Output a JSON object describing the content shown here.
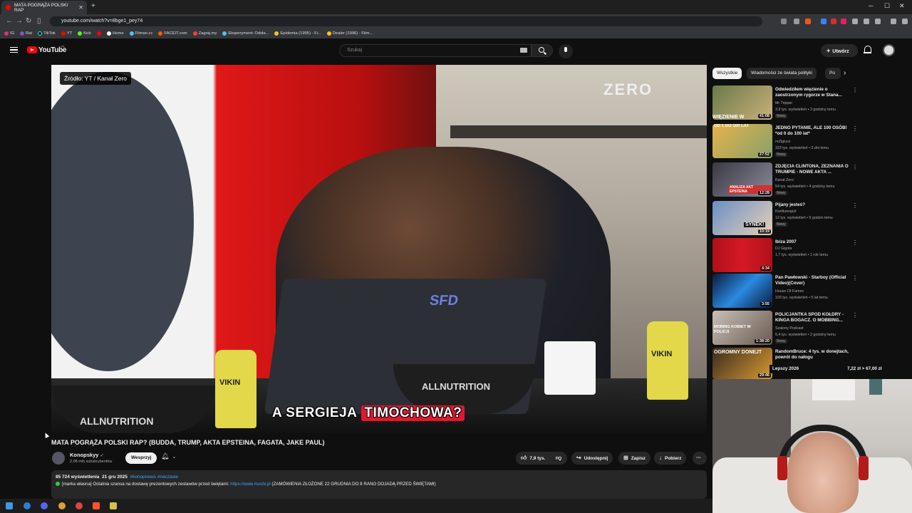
{
  "browser": {
    "tab_title": "MATA POGRĄŻA POLSKI RAP",
    "url": "youtube.com/watch?v=8bge1_pey74",
    "bookmarks": [
      "IG",
      "Rat",
      "TikTok",
      "YT",
      "Kick",
      "Home",
      "Filman.cc",
      "FACEIT.com",
      "Zagraj.my",
      "Eksperyment: Odsła...",
      "Epidemia (1995) - Fi...",
      "Dealer (1996) - Film..."
    ]
  },
  "header": {
    "logo_text": "YouTube",
    "country": "PL",
    "search_placeholder": "Szukaj",
    "create_label": "Utwórz"
  },
  "player": {
    "source_badge": "Źródło: YT / Kanał Zero",
    "watermark": "ZERO",
    "caption_a": "A SERGIEJA",
    "caption_b": "TIMOCHOWA?",
    "laptop_sticker": "SFD",
    "bowl_brand": "ALLNUTRITION",
    "bottle_label": "VIKIN"
  },
  "video": {
    "title": "MATA POGRĄŻA POLSKI RAP? (BUDDA, TRUMP, AKTA EPSTEINA, FAGATA, JAKE PAUL)",
    "channel": "Konopskyy",
    "subscribers": "2,08 mln subskrybentów",
    "support_label": "Wesprzyj",
    "likes": "7,9 tys.",
    "share_label": "Udostępnij",
    "save_label": "Zapisz",
    "download_label": "Pobierz",
    "views": "85 724 wyświetlenia",
    "date": "21 gru 2025",
    "tags": "#konopnews #naczasie",
    "desc_prefix": "[marka własna] Ostatnia szansa na dostawę prezentowych zestawów przed świętami:",
    "desc_link": "https://www.mushi.pl",
    "desc_suffix": "(ZAMÓWIENIA ZŁOŻONE 22 GRUDNIA DO 8 RANO DOJADĄ PRZED ŚWIĘTAMI)"
  },
  "sidebar": {
    "chips": [
      "Wszystkie",
      "Wiadomości ze świata polityki",
      "Po"
    ],
    "items": [
      {
        "title": "Odwiedziłem więzienie o zaostrzonym rygorze w Stana...",
        "channel": "Mr Tripper",
        "meta": "3,9 tys. wyświetleń • 3 godziny temu",
        "badge": "Nowy",
        "duration": "41:08",
        "thumb_text": "WIĘZIENIE W"
      },
      {
        "title": "JEDNO PYTANIE, ALE 100 OSÓB! *od 0 do 100 lat*",
        "channel": "reZigiusz",
        "meta": "323 tys. wyświetleń • 3 dni temu",
        "badge": "Nowy",
        "duration": "27:52",
        "thumb_text": "OD 1 DO 100 LAT"
      },
      {
        "title": "ZDJĘCIA CLINTONA, ZEZNANIA O TRUMPIE - NOWE AKTA ...",
        "channel": "Kanał Zero",
        "meta": "54 tys. wyświetleń • 4 godziny temu",
        "badge": "Nowy",
        "duration": "12:28",
        "thumb_text": "ANALIZA AKT EPSTEINA"
      },
      {
        "title": "Pijany jesteś?",
        "channel": "Konfiurespol",
        "meta": "12 tys. wyświetleń • 6 godzin temu",
        "badge": "Nowy",
        "duration": "10:19",
        "thumb_text": "SYNEK!"
      },
      {
        "title": "Ibiza 2007",
        "channel": "DJ Gigola",
        "meta": "1,7 tys. wyświetleń • 1 rok temu",
        "badge": "",
        "duration": "4:34",
        "thumb_text": ""
      },
      {
        "title": "Pan Pawłowski - Starboy (Official Video)(Cover)",
        "channel": "House Of Fames",
        "meta": "103 tys. wyświetleń • 5 lat temu",
        "badge": "",
        "duration": "3:55",
        "thumb_text": ""
      },
      {
        "title": "POLICJANTKA SPOD KOŁDRY - KINGA BOGACZ. O MOBBING...",
        "channel": "Szalony Podcast",
        "meta": "5,4 tys. wyświetleń • 2 godziny temu",
        "badge": "Nowy",
        "duration": "1:38:20",
        "thumb_text": "MOBING KOBIET W POLICJI"
      },
      {
        "title": "RandomBruce: 4 tys. w donejtach, powrót do nałogu",
        "channel": "",
        "meta": "",
        "badge": "",
        "duration": "29:46",
        "thumb_text": "OGROMNY DONEJT"
      }
    ],
    "ticker_left": "Lepszy 2026",
    "ticker_right": "7,22 zł > 67,00 zł"
  }
}
